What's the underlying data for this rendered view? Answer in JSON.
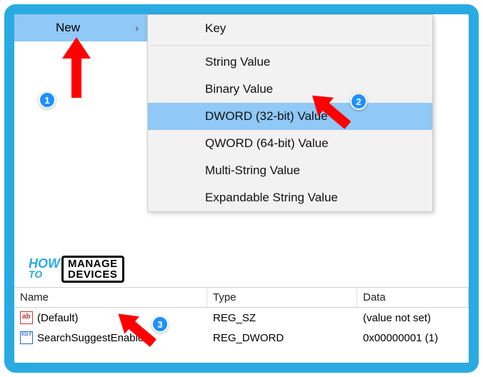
{
  "context_menu": {
    "new_label": "New",
    "submenu": {
      "key": "Key",
      "string": "String Value",
      "binary": "Binary Value",
      "dword": "DWORD (32-bit) Value",
      "qword": "QWORD (64-bit) Value",
      "multistring": "Multi-String Value",
      "expandable": "Expandable String Value"
    }
  },
  "registry": {
    "headers": {
      "name": "Name",
      "type": "Type",
      "data": "Data"
    },
    "rows": [
      {
        "icon": "str",
        "name": "(Default)",
        "type": "REG_SZ",
        "data": "(value not set)"
      },
      {
        "icon": "dword",
        "name": "SearchSuggestEnabled",
        "type": "REG_DWORD",
        "data": "0x00000001 (1)"
      }
    ]
  },
  "annotations": {
    "badge1": "1",
    "badge2": "2",
    "badge3": "3"
  },
  "watermark": {
    "how": "HOW",
    "to": "TO",
    "manage_devices": "MANAGE\nDEVICES"
  }
}
